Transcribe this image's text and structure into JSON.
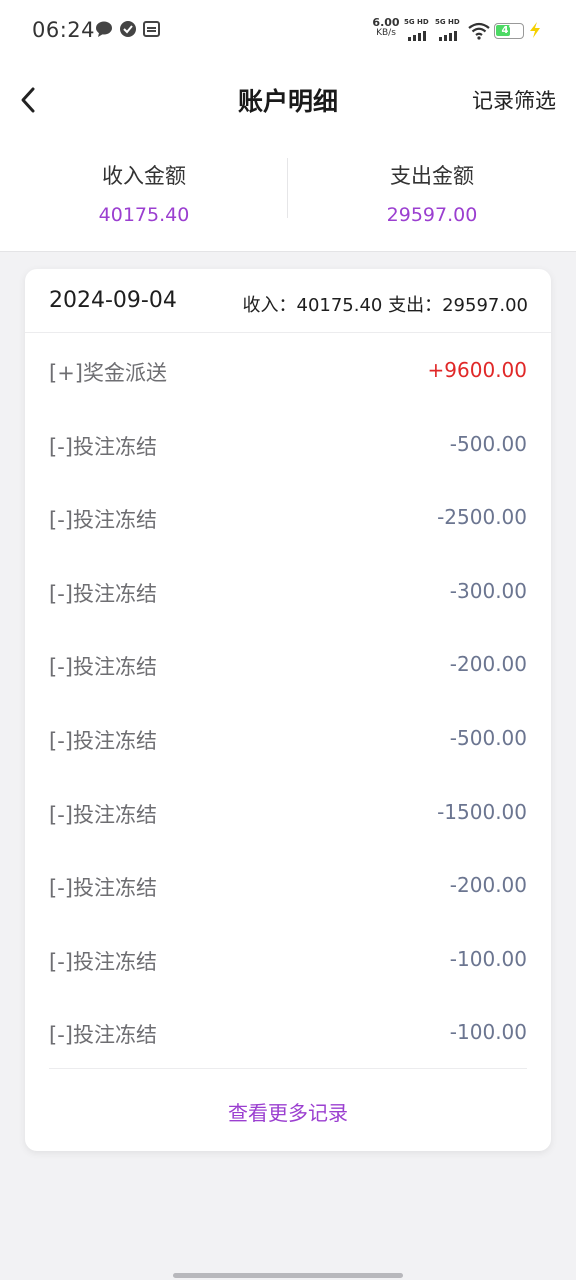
{
  "status_bar": {
    "time": "06:24",
    "speed_value": "6.00",
    "speed_unit": "KB/s",
    "signal1": "5G HD",
    "signal2": "5G HD",
    "battery": "47",
    "icons": [
      "message-icon",
      "check-circle-icon",
      "mail-icon",
      "wifi-icon",
      "battery-icon",
      "charging-icon"
    ]
  },
  "header": {
    "title": "账户明细",
    "filter_label": "记录筛选",
    "back_icon": "chevron-left-icon"
  },
  "summary": {
    "income_label": "收入金额",
    "income_value": "40175.40",
    "expense_label": "支出金额",
    "expense_value": "29597.00",
    "accent_color": "#9b3fd0"
  },
  "day_group": {
    "date": "2024-09-04",
    "totals": "收入：40175.40 支出：29597.00",
    "records": [
      {
        "label": "[+]奖金派送",
        "amount": "+9600.00",
        "positive": true
      },
      {
        "label": "[-]投注冻结",
        "amount": "-500.00",
        "positive": false
      },
      {
        "label": "[-]投注冻结",
        "amount": "-2500.00",
        "positive": false
      },
      {
        "label": "[-]投注冻结",
        "amount": "-300.00",
        "positive": false
      },
      {
        "label": "[-]投注冻结",
        "amount": "-200.00",
        "positive": false
      },
      {
        "label": "[-]投注冻结",
        "amount": "-500.00",
        "positive": false
      },
      {
        "label": "[-]投注冻结",
        "amount": "-1500.00",
        "positive": false
      },
      {
        "label": "[-]投注冻结",
        "amount": "-200.00",
        "positive": false
      },
      {
        "label": "[-]投注冻结",
        "amount": "-100.00",
        "positive": false
      },
      {
        "label": "[-]投注冻结",
        "amount": "-100.00",
        "positive": false
      }
    ],
    "more_label": "查看更多记录"
  },
  "colors": {
    "positive_amount": "#e02828",
    "negative_amount": "#6b7590"
  }
}
